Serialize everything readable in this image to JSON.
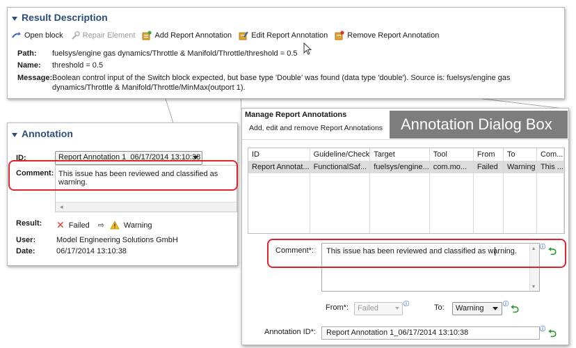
{
  "result": {
    "title": "Result Description",
    "toolbar": {
      "open_block": "Open block",
      "repair_element": "Repair Element",
      "add_annotation": "Add Report Annotation",
      "edit_annotation": "Edit Report Annotation",
      "remove_annotation": "Remove Report Annotation"
    },
    "path_label": "Path:",
    "path_value": "fuelsys/engine gas dynamics/Throttle & Manifold/Throttle/threshold = 0.5",
    "name_label": "Name:",
    "name_value": "threshold = 0.5",
    "message_label": "Message:",
    "message_line1": "Boolean control input of the Switch block expected, but base type 'Double' was found (data type 'double'). Source is: fuelsys/engine gas",
    "message_line2": "dynamics/Throttle & Manifold/Throttle/MinMax(outport 1)."
  },
  "annotation": {
    "title": "Annotation",
    "id_label": "ID:",
    "id_value": "Report Annotation 1_06/17/2014 13:10:38",
    "comment_label": "Comment:",
    "comment_value": "This issue has been reviewed and classified as warning.",
    "result_label": "Result:",
    "result_failed": "Failed",
    "result_warning": "Warning",
    "user_label": "User:",
    "user_value": "Model Engineering Solutions GmbH",
    "date_label": "Date:",
    "date_value": "06/17/2014 13:10:38"
  },
  "dialog": {
    "title": "Manage Report Annotations",
    "subtitle": "Add, edit and remove Report Annotations",
    "overlay_label": "Annotation Dialog Box",
    "columns": [
      "ID",
      "Guideline/Check",
      "Target",
      "Tool",
      "From",
      "To",
      "Com..."
    ],
    "rows": [
      [
        "Report Annotat...",
        "FunctionalSaf...",
        "fuelsys/engine...",
        "com.mo...",
        "Failed",
        "Warning",
        "This ..."
      ]
    ],
    "comment_label": "Comment*:",
    "comment_value": "This issue has been reviewed and classified as warning.",
    "from_label": "From*:",
    "from_value": "Failed",
    "to_label": "To:",
    "to_value": "Warning",
    "annotation_id_label": "Annotation ID*:",
    "annotation_id_value": "Report Annotation 1_06/17/2014 13:10:38"
  },
  "colors": {
    "accent": "#2a4e7a",
    "highlight_red": "#e0242b",
    "overlay_bg": "#7d7d7d",
    "success_green": "#2f9a2f"
  }
}
